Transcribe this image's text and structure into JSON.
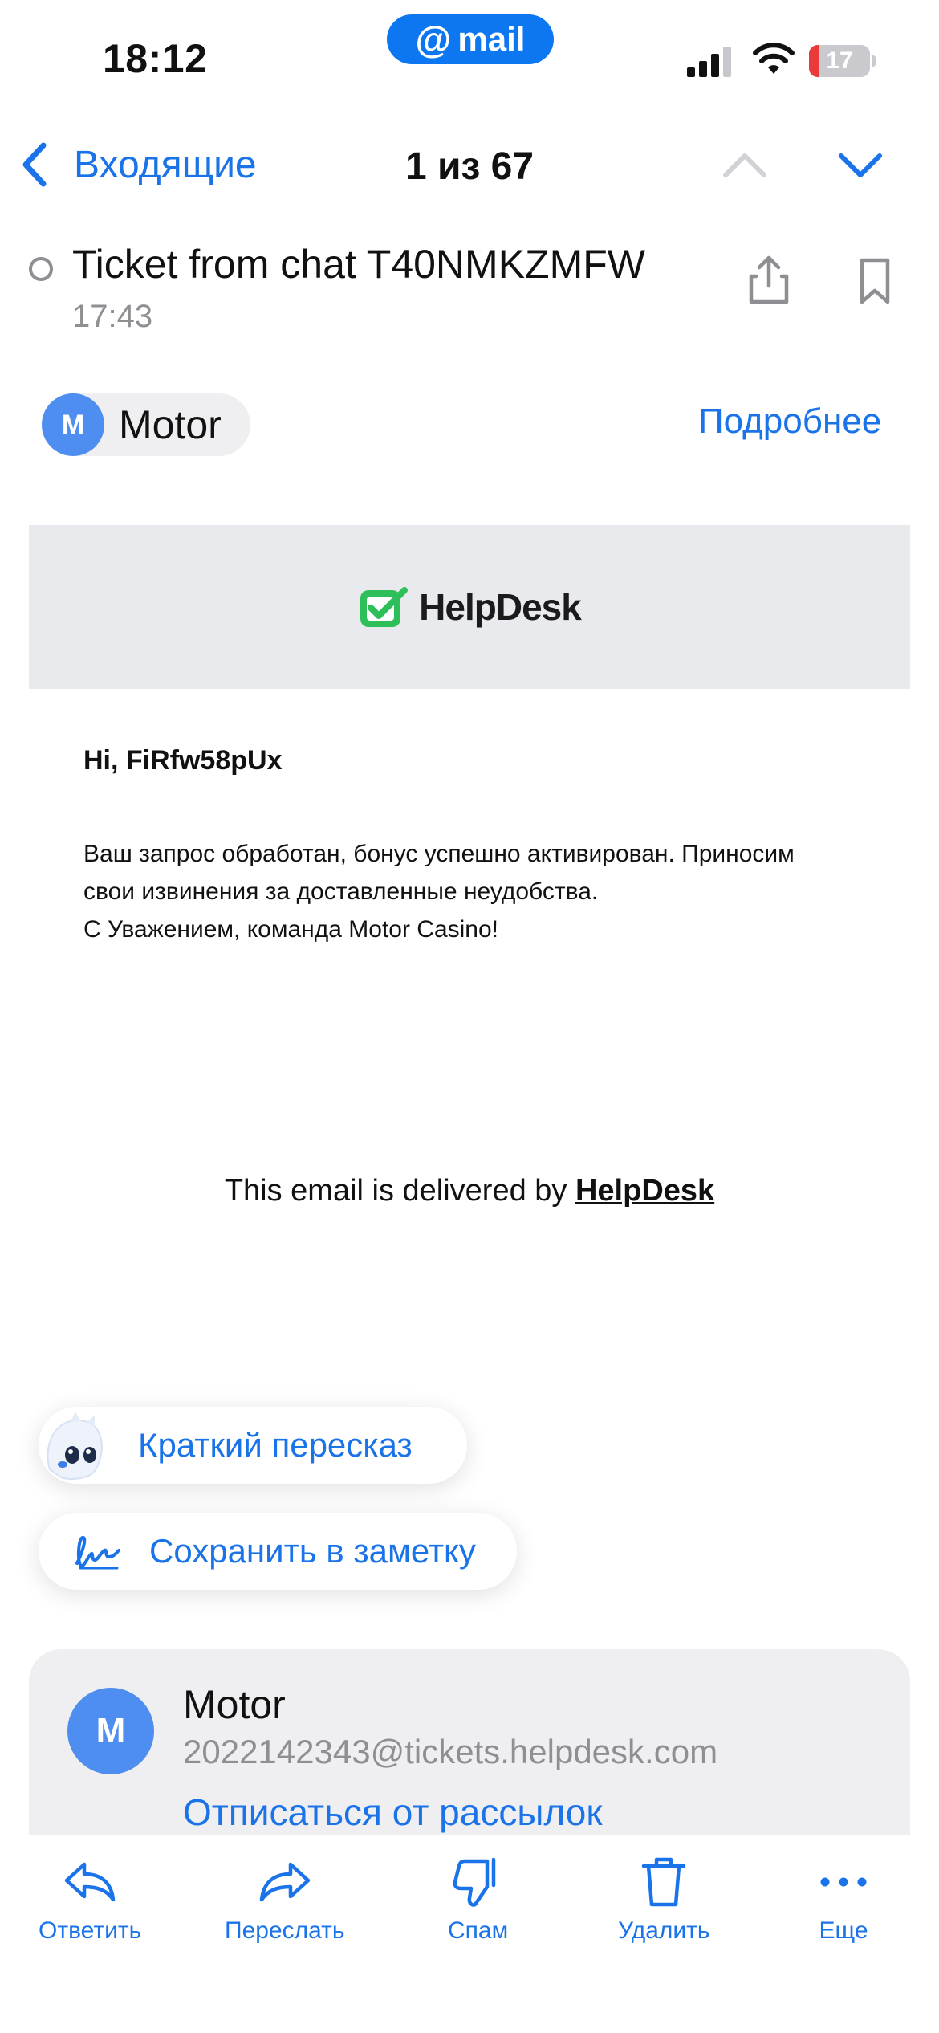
{
  "status_bar": {
    "time": "18:12",
    "mail_badge": "mail",
    "mail_badge_at": "@",
    "battery_level": "17",
    "battery_fraction": 0.17
  },
  "nav": {
    "back_label": "Входящие",
    "counter": "1 из 67"
  },
  "message": {
    "subject": "Ticket from chat T40NMKZMFW",
    "time": "17:43",
    "sender_initial": "M",
    "sender_name": "Motor",
    "details_link": "Подробнее"
  },
  "email_body": {
    "logo_text": "HelpDesk",
    "greeting": "Hi, FiRfw58pUx",
    "lines": [
      "Ваш запрос обработан, бонус успешно активирован. Приносим",
      "свои извинения за доставленные неудобства.",
      "С Уважением, команда Motor Casino!"
    ],
    "delivered_prefix": "This email is delivered by ",
    "delivered_link": "HelpDesk"
  },
  "actions": {
    "summary_label": "Краткий пересказ",
    "note_label": "Сохранить в заметку"
  },
  "sender_card": {
    "initial": "M",
    "name": "Motor",
    "email": "2022142343@tickets.helpdesk.com",
    "unsubscribe": "Отписаться от рассылок"
  },
  "toolbar": {
    "reply": "Ответить",
    "forward": "Переслать",
    "spam": "Спам",
    "delete": "Удалить",
    "more": "Еще"
  },
  "colors": {
    "accent": "#1a73e8",
    "mail_badge": "#0d77f2",
    "avatar": "#4d8ef0",
    "helpdesk_green": "#2fbf5a",
    "battery_low": "#ea3b3b"
  },
  "icons": [
    "chevron-left-icon",
    "chevron-up-icon",
    "chevron-down-icon",
    "share-icon",
    "bookmark-icon",
    "ghost-mascot-icon",
    "signature-note-icon",
    "reply-icon",
    "forward-icon",
    "thumbs-down-icon",
    "trash-icon",
    "more-dots-icon",
    "helpdesk-logo-icon",
    "signal-icon",
    "wifi-icon",
    "battery-icon"
  ]
}
